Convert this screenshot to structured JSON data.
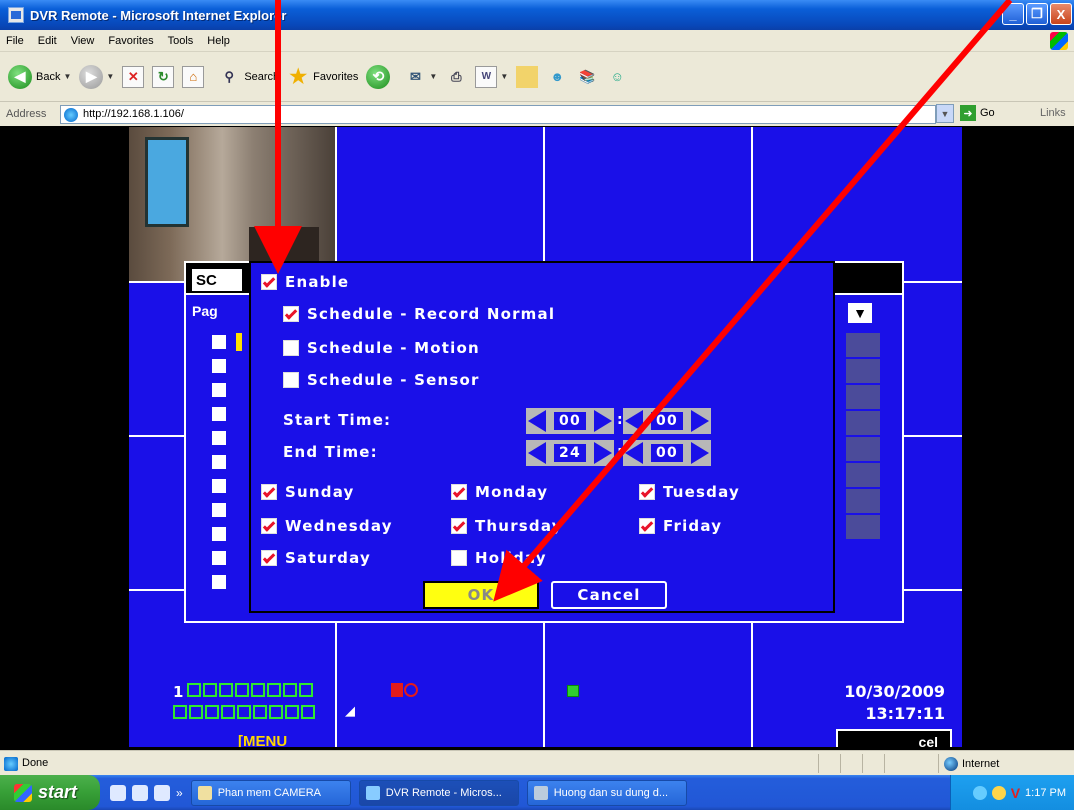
{
  "window": {
    "title": "DVR Remote - Microsoft Internet Explorer",
    "minimize": "_",
    "maximize": "❐",
    "close": "X"
  },
  "menu": [
    "File",
    "Edit",
    "View",
    "Favorites",
    "Tools",
    "Help"
  ],
  "toolbar": {
    "back": "Back",
    "search": "Search",
    "favorites": "Favorites"
  },
  "address": {
    "label": "Address",
    "url": "http://192.168.1.106/",
    "go": "Go",
    "links": "Links"
  },
  "dvr_bg": {
    "header_label": "SC",
    "page_label": "Pag",
    "menu_label": "[MENU",
    "cancel_label": "cel"
  },
  "dialog": {
    "enable": {
      "label": "Enable",
      "checked": true
    },
    "schedule_normal": {
      "label": "Schedule - Record Normal",
      "checked": true
    },
    "schedule_motion": {
      "label": "Schedule - Motion",
      "checked": false
    },
    "schedule_sensor": {
      "label": "Schedule - Sensor",
      "checked": false
    },
    "start_time_label": "Start Time:",
    "end_time_label": "End Time:",
    "start_hour": "00",
    "start_min": "00",
    "end_hour": "24",
    "end_min": "00",
    "colon": ":",
    "days": {
      "sunday": {
        "label": "Sunday",
        "checked": true
      },
      "monday": {
        "label": "Monday",
        "checked": true
      },
      "tuesday": {
        "label": "Tuesday",
        "checked": true
      },
      "wednesday": {
        "label": "Wednesday",
        "checked": true
      },
      "thursday": {
        "label": "Thursday",
        "checked": true
      },
      "friday": {
        "label": "Friday",
        "checked": true
      },
      "saturday": {
        "label": "Saturday",
        "checked": true
      },
      "holiday": {
        "label": "Holiday",
        "checked": false
      }
    },
    "ok": "OK",
    "cancel": "Cancel"
  },
  "osd": {
    "channel_number": "1",
    "date": "10/30/2009",
    "time": "13:17:11"
  },
  "statusbar": {
    "done": "Done",
    "zone": "Internet"
  },
  "taskbar": {
    "start": "start",
    "more": "»",
    "tasks": [
      "Phan mem CAMERA",
      "DVR Remote - Micros...",
      "Huong dan su dung d..."
    ],
    "clock": "1:17 PM",
    "tray_letter": "V"
  },
  "colors": {
    "dvr_blue": "#1a10e8",
    "ok_yellow": "#ffff10",
    "arrow_red": "#ff0000"
  }
}
